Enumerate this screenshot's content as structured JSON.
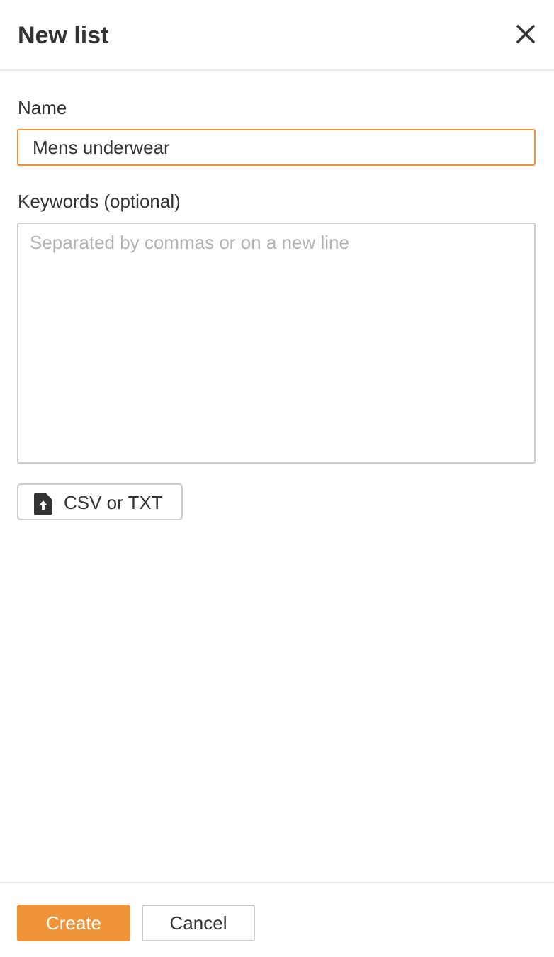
{
  "dialog": {
    "title": "New list",
    "close_icon": "close-icon"
  },
  "form": {
    "name_label": "Name",
    "name_value": "Mens underwear",
    "keywords_label": "Keywords (optional)",
    "keywords_placeholder": "Separated by commas or on a new line",
    "keywords_value": "",
    "upload_icon": "file-upload-icon",
    "upload_label": "CSV or TXT"
  },
  "footer": {
    "create_label": "Create",
    "cancel_label": "Cancel"
  },
  "colors": {
    "accent": "#f0943a",
    "text": "#333333",
    "border": "#cccccc",
    "placeholder": "#b3b3b3",
    "divider": "#e8e8e8"
  }
}
